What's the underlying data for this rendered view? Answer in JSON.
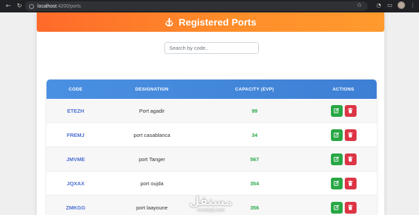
{
  "browser": {
    "url_host": "localhost",
    "url_rest": ":4200/ports"
  },
  "header": {
    "title": "Registered Ports"
  },
  "search": {
    "placeholder": "Search by code.."
  },
  "table": {
    "columns": [
      "CODE",
      "DESIGNATION",
      "CAPACITY (EVP)",
      "ACTIONS"
    ],
    "rows": [
      {
        "code": "ETEZH",
        "designation": "Port agadir",
        "capacity": "99"
      },
      {
        "code": "FREMJ",
        "designation": "port casablanca",
        "capacity": "34"
      },
      {
        "code": "JMVME",
        "designation": "port Tanger",
        "capacity": "567"
      },
      {
        "code": "JQXAX",
        "designation": "port oujda",
        "capacity": "354"
      },
      {
        "code": "ZMKGG",
        "designation": "port laayoune",
        "capacity": "356"
      }
    ]
  },
  "watermark": {
    "arabic": "مستقل",
    "latin": "mostaql.com"
  },
  "colors": {
    "header_orange": "#ff7a2a",
    "table_header_blue": "#4a90e2",
    "code_blue": "#4d6fd4",
    "capacity_green": "#28a745",
    "edit_green": "#28a745",
    "delete_red": "#dc3545"
  },
  "icons": {
    "header": "anchor-icon",
    "edit": "edit-icon",
    "delete": "trash-icon"
  }
}
